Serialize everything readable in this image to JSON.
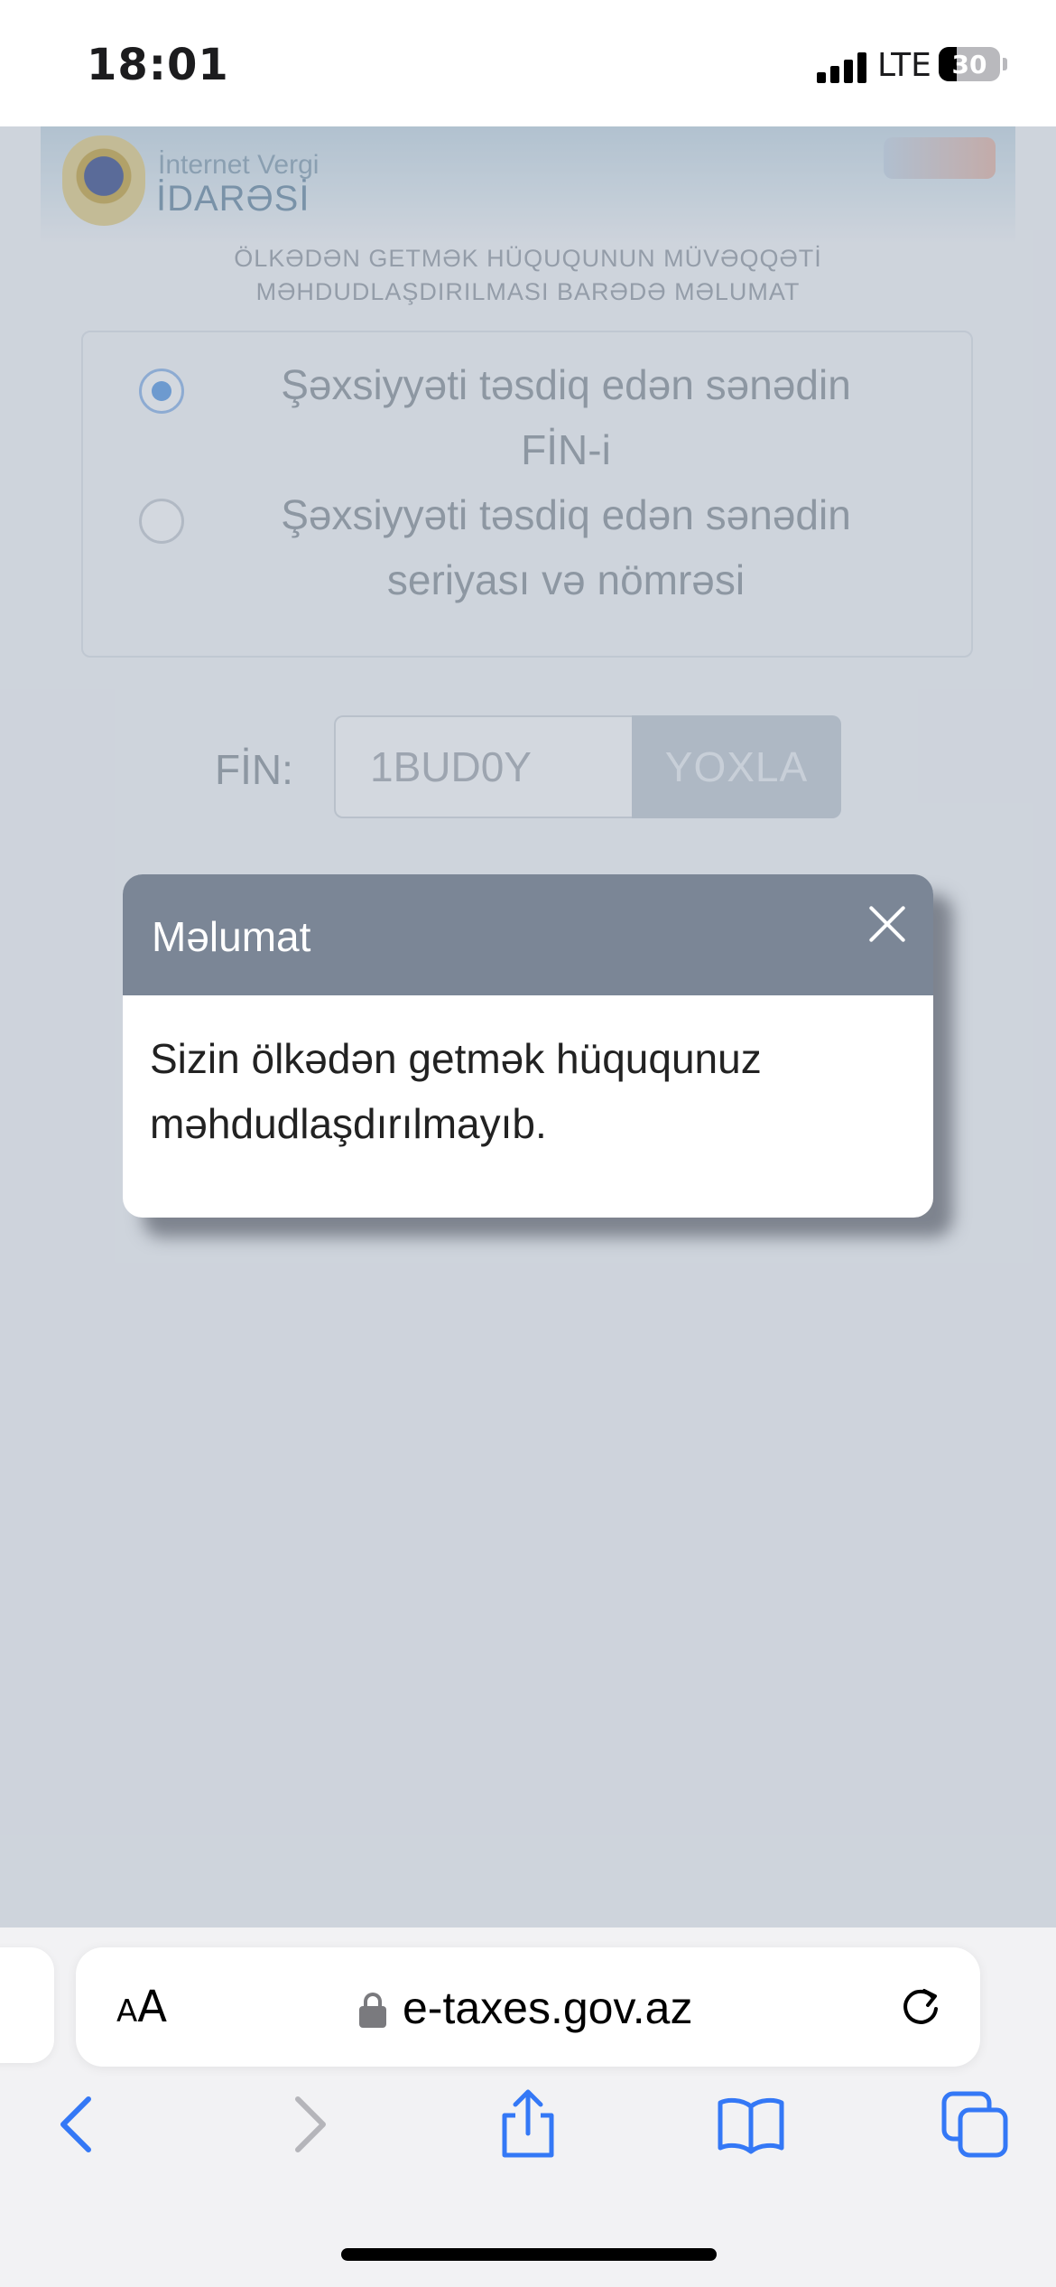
{
  "status_bar": {
    "time": "18:01",
    "network": "LTE",
    "battery": "30",
    "battery_level": 0.3
  },
  "page": {
    "banner": {
      "line1": "İnternet Vergi",
      "line2": "İDARƏSİ"
    },
    "headline_line1": "ÖLKƏDƏN GETMƏK HÜQUQUNUN MÜVƏQQƏTİ",
    "headline_line2": "MƏHDUDLAŞDIRILMASI BARƏDƏ MƏLUMAT",
    "options": [
      {
        "line1": "Şəxsiyyəti təsdiq edən sənədin",
        "line2": "FİN-i",
        "selected": true
      },
      {
        "line1": "Şəxsiyyəti təsdiq edən sənədin",
        "line2": "seriyası və nömrəsi",
        "selected": false
      }
    ],
    "fin_label": "FİN:",
    "fin_value": "1BUD0Y",
    "check_button": "YOXLA"
  },
  "dialog": {
    "title": "Məlumat",
    "message_line1": "Sizin ölkədən getmək hüququnuz",
    "message_line2": "məhdudlaşdırılmayıb."
  },
  "browser": {
    "aa_small": "A",
    "aa_big": "A",
    "url": "e-taxes.gov.az",
    "accent_color": "#3478f6"
  }
}
